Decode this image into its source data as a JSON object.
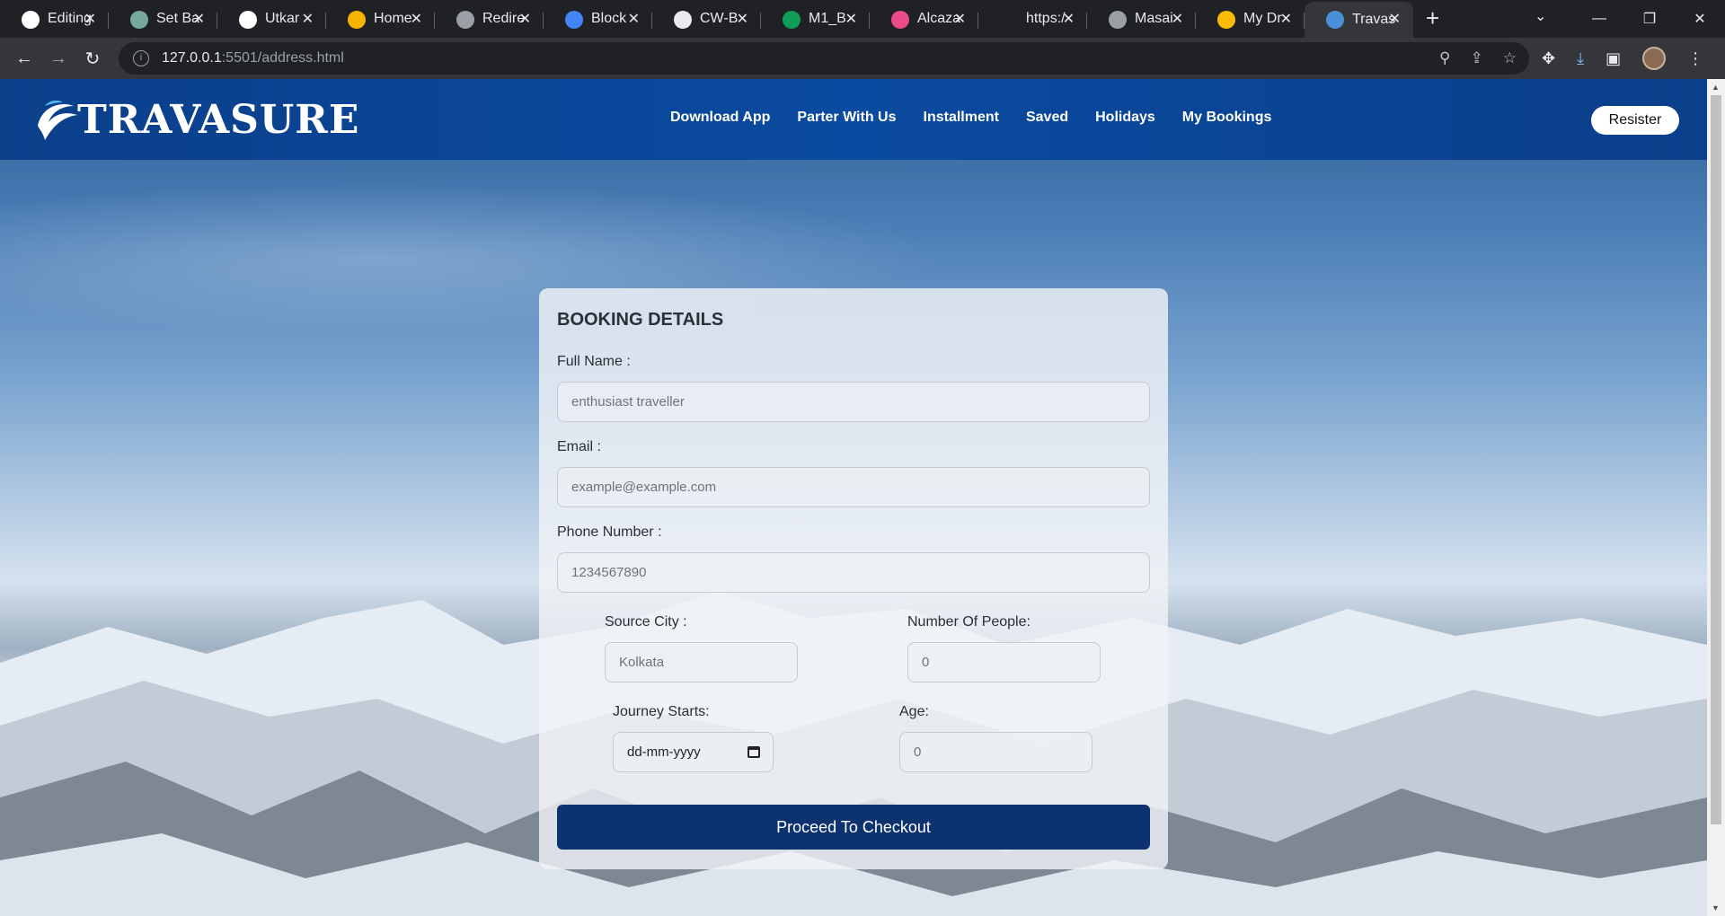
{
  "browser": {
    "tabs": [
      {
        "title": "Editing",
        "favicon": "github-icon",
        "color": "#ffffff"
      },
      {
        "title": "Set Ba",
        "favicon": "openai-icon",
        "color": "#74aa9c"
      },
      {
        "title": "Utkar",
        "favicon": "github-icon",
        "color": "#ffffff"
      },
      {
        "title": "Home",
        "favicon": "doc-icon",
        "color": "#f4b400"
      },
      {
        "title": "Redire",
        "favicon": "globe-icon",
        "color": "#9aa0a6"
      },
      {
        "title": "Block",
        "favicon": "block-icon",
        "color": "#4285f4"
      },
      {
        "title": "CW-B",
        "favicon": "file-icon",
        "color": "#e8eaed"
      },
      {
        "title": "M1_B",
        "favicon": "sheets-icon",
        "color": "#0f9d58"
      },
      {
        "title": "Alcaza",
        "favicon": "dribbble-icon",
        "color": "#ea4c89"
      },
      {
        "title": "https:/",
        "favicon": "",
        "color": "#202124"
      },
      {
        "title": "Masai",
        "favicon": "globe-icon",
        "color": "#9aa0a6"
      },
      {
        "title": "My Dr",
        "favicon": "drive-icon",
        "color": "#fbbc04"
      },
      {
        "title": "Travas",
        "favicon": "travasure-icon",
        "color": "#4a90d9",
        "active": true
      }
    ],
    "new_tab": "+",
    "url_host": "127.0.0.1",
    "url_path": ":5501/address.html"
  },
  "site": {
    "logo_text": "TRAVASURE",
    "nav": [
      "Download App",
      "Parter With Us",
      "Installment",
      "Saved",
      "Holidays",
      "My Bookings"
    ],
    "register_label": "Resister"
  },
  "form": {
    "title": "BOOKING DETAILS",
    "full_name_label": "Full Name :",
    "full_name_placeholder": "enthusiast traveller",
    "email_label": "Email :",
    "email_placeholder": "example@example.com",
    "phone_label": "Phone Number :",
    "phone_placeholder": "1234567890",
    "source_city_label": "Source City :",
    "source_city_placeholder": "Kolkata",
    "people_label": "Number Of People:",
    "people_placeholder": "0",
    "journey_label": "Journey Starts:",
    "journey_placeholder": "dd-mm-yyyy",
    "age_label": "Age:",
    "age_placeholder": "0",
    "submit_label": "Proceed To Checkout"
  }
}
